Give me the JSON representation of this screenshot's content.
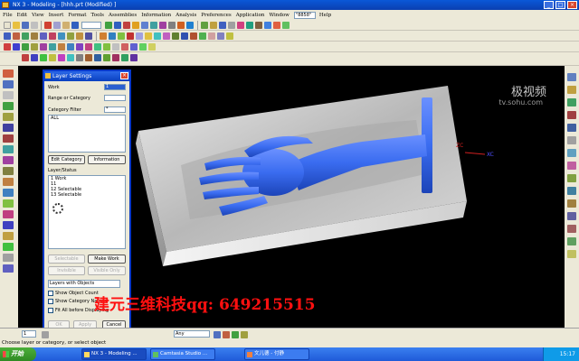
{
  "window": {
    "title": "NX 3 - Modeling - [hhh.prt (Modified) ]"
  },
  "menu": {
    "items": [
      "File",
      "Edit",
      "View",
      "Insert",
      "Format",
      "Tools",
      "Assemblies",
      "Information",
      "Analysis",
      "Preferences",
      "Application",
      "Window"
    ],
    "combo_value": "\"8858\"",
    "help": "Help"
  },
  "viewport": {
    "watermark": "极视频",
    "watermark_url": "tv.sohu.com",
    "axis_label": "XC",
    "axis_label2": "ZC",
    "promo_text": "建元三维科技qq: 649215515"
  },
  "dialog": {
    "title": "Layer Settings",
    "work_label": "Work",
    "work_value": "1",
    "range_label": "Range or Category",
    "filter_label": "Category Filter",
    "filter_value": "*",
    "categories": [
      "ALL"
    ],
    "edit_category": "Edit Category",
    "information": "Information",
    "layer_status_label": "Layer/Status",
    "layers": [
      "1 Work",
      "11",
      "12 Selectable",
      "13 Selectable"
    ],
    "selectable": "Selectable",
    "make_work": "Make Work",
    "invisible": "Invisible",
    "visible_only": "Visible Only",
    "layers_select": "Layers with Objects",
    "show_object_count": "Show Object Count",
    "show_category_names": "Show Category Names",
    "fit_all": "Fit All before Displaying",
    "ok": "OK",
    "apply": "Apply",
    "cancel": "Cancel"
  },
  "statusbar": {
    "layer_value": "1",
    "filter_value": "Any"
  },
  "prompt": "Choose layer or category, or select object",
  "taskbar": {
    "start": "开始",
    "items": [
      {
        "label": "NX 3 - Modeling ...",
        "active": true
      },
      {
        "label": "Camtasia Studio ...",
        "active": false
      },
      {
        "label": "文儿德 - 付静",
        "active": false
      }
    ],
    "clock": "15:17"
  },
  "colors": {
    "model_blue": "#3a6cf0",
    "title_blue": "#0a58d8",
    "promo_red": "#ff1010"
  }
}
